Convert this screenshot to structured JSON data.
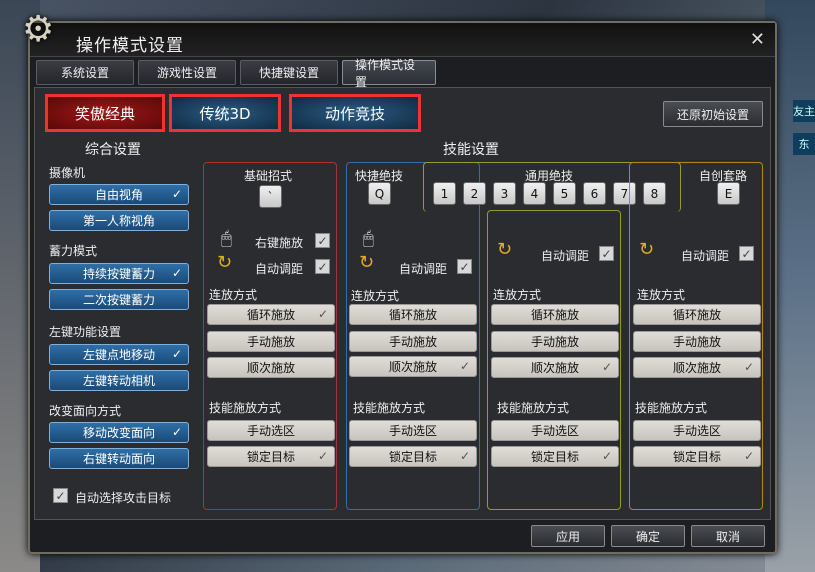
{
  "window": {
    "title": "操作模式设置",
    "close": "✕"
  },
  "tabs": [
    "系统设置",
    "游戏性设置",
    "快捷键设置",
    "操作模式设置"
  ],
  "modes": [
    "笑傲经典",
    "传统3D",
    "动作竞技"
  ],
  "reset": "还原初始设置",
  "general": {
    "title": "综合设置",
    "camera": "摄像机",
    "free_view": "自由视角",
    "first_person": "第一人称视角",
    "charge": "蓄力模式",
    "hold_charge": "持续按键蓄力",
    "double_charge": "二次按键蓄力",
    "left": "左键功能设置",
    "left_move": "左键点地移动",
    "left_cam": "左键转动相机",
    "dir": "改变面向方式",
    "dir_move": "移动改变面向",
    "dir_right": "右键转动面向",
    "auto_target": "自动选择攻击目标"
  },
  "skills": {
    "title": "技能设置",
    "basic": "基础招式",
    "basic_key": "`",
    "quick": "快捷绝技",
    "quick_key": "Q",
    "general": "通用绝技",
    "general_keys": [
      "1",
      "2",
      "3",
      "4",
      "5",
      "6",
      "7",
      "8"
    ],
    "custom": "自创套路",
    "custom_key": "E",
    "right_cast": "右键施放",
    "auto_range": "自动调距",
    "combo": "连放方式",
    "loop": "循环施放",
    "manual": "手动施放",
    "seq": "顺次施放",
    "cast_mode": "技能施放方式",
    "manual_area": "手动选区",
    "lock": "锁定目标"
  },
  "footer": {
    "apply": "应用",
    "ok": "确定",
    "cancel": "取消"
  },
  "bg": {
    "tag1": "友主",
    "tag2": "东"
  }
}
